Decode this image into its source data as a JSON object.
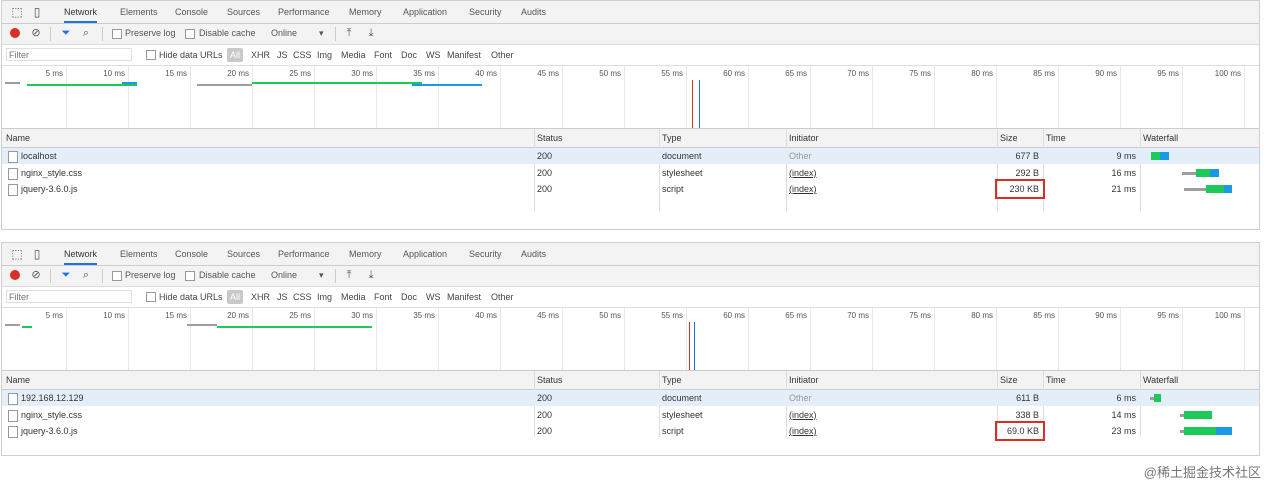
{
  "tabs": [
    "Network",
    "Elements",
    "Console",
    "Sources",
    "Performance",
    "Memory",
    "Application",
    "Security",
    "Audits"
  ],
  "toolbar": {
    "preserve_log": "Preserve log",
    "disable_cache": "Disable cache",
    "throttle": "Online"
  },
  "filter": {
    "placeholder": "Filter",
    "hide_data_urls": "Hide data URLs",
    "types": [
      "All",
      "XHR",
      "JS",
      "CSS",
      "Img",
      "Media",
      "Font",
      "Doc",
      "WS",
      "Manifest",
      "Other"
    ]
  },
  "timeline_ticks": [
    "5 ms",
    "10 ms",
    "15 ms",
    "20 ms",
    "25 ms",
    "30 ms",
    "35 ms",
    "40 ms",
    "45 ms",
    "50 ms",
    "55 ms",
    "60 ms",
    "65 ms",
    "70 ms",
    "75 ms",
    "80 ms",
    "85 ms",
    "90 ms",
    "95 ms",
    "100 ms"
  ],
  "columns": [
    "Name",
    "Status",
    "Type",
    "Initiator",
    "Size",
    "Time",
    "Waterfall"
  ],
  "colors": {
    "record": "#d93025",
    "accent": "#1a73e8",
    "highlight": "#d93025",
    "waiting": "#9e9e9e",
    "receiving": "#1ec95b",
    "download": "#1a9ae6"
  },
  "panels": [
    {
      "rows": [
        {
          "name": "localhost",
          "status": "200",
          "type": "document",
          "initiator": "Other",
          "size": "677 B",
          "time": "9 ms",
          "selected": true
        },
        {
          "name": "nginx_style.css",
          "status": "200",
          "type": "stylesheet",
          "initiator": "(index)",
          "size": "292 B",
          "time": "16 ms",
          "selected": false
        },
        {
          "name": "jquery-3.6.0.js",
          "status": "200",
          "type": "script",
          "initiator": "(index)",
          "size": "230 KB",
          "time": "21 ms",
          "selected": false
        }
      ]
    },
    {
      "rows": [
        {
          "name": "192.168.12.129",
          "status": "200",
          "type": "document",
          "initiator": "Other",
          "size": "611 B",
          "time": "6 ms",
          "selected": true
        },
        {
          "name": "nginx_style.css",
          "status": "200",
          "type": "stylesheet",
          "initiator": "(index)",
          "size": "338 B",
          "time": "14 ms",
          "selected": false
        },
        {
          "name": "jquery-3.6.0.js",
          "status": "200",
          "type": "script",
          "initiator": "(index)",
          "size": "69.0 KB",
          "time": "23 ms",
          "selected": false
        }
      ]
    }
  ],
  "watermark": "@稀土掘金技术社区"
}
